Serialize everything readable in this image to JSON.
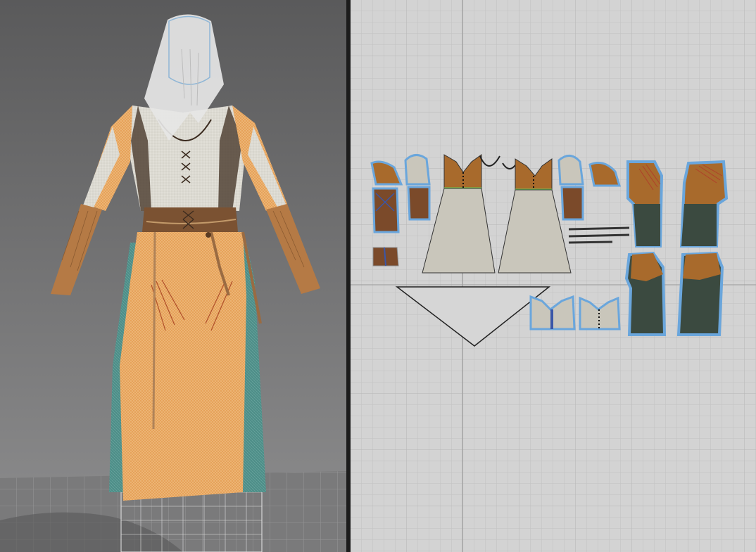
{
  "app": {
    "views": [
      "3d-avatar-view",
      "2d-pattern-view"
    ]
  },
  "colors": {
    "viewport_top": "#5b5b5c",
    "viewport_bottom": "#8c8c8d",
    "grid_bg": "#d2d2d2",
    "grid_line": "#bdbdbd",
    "axis_line": "#9a9a9a",
    "fabric_orange": "#e3a35c",
    "fabric_teal": "#4a8a86",
    "fabric_cream": "#c9c6bb",
    "leather": "#7b5232",
    "pattern_brown": "#a86a2c",
    "pattern_dark": "#3b4a40",
    "pattern_outline": "#6aa6dc",
    "seam_green": "#6ccf58"
  },
  "icons": [
    "avatar-garment-icon",
    "pattern-pieces-icon"
  ]
}
